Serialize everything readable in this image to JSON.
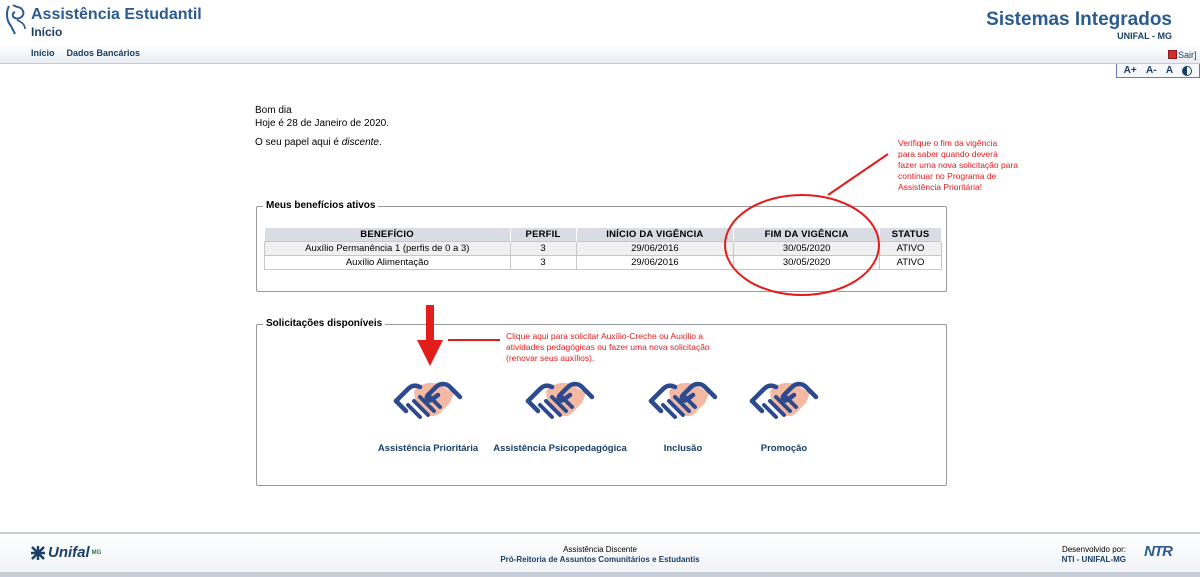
{
  "header": {
    "app_title": "Assistência Estudantil",
    "page_subtitle": "Início",
    "menu": [
      {
        "label": "Início"
      },
      {
        "label": "Dados Bancários"
      }
    ],
    "system_title": "Sistemas Integrados",
    "system_subtitle": "UNIFAL - MG",
    "logout_label": "Sair]",
    "accessibility": [
      "A+",
      "A-",
      "A"
    ]
  },
  "greeting": {
    "line1": "Bom dia",
    "line2": "Hoje é 28 de Janeiro de 2020.",
    "role_prefix": "O seu papel aqui é ",
    "role_value": "discente",
    "role_suffix": "."
  },
  "benefits": {
    "legend": "Meus benefícios ativos",
    "columns": [
      "BENEFÍCIO",
      "PERFIL",
      "INÍCIO DA VIGÊNCIA",
      "FIM DA VIGÊNCIA",
      "STATUS"
    ],
    "rows": [
      [
        "Auxílio Permanência 1 (perfis de 0 a 3)",
        "3",
        "29/06/2016",
        "30/05/2020",
        "ATIVO"
      ],
      [
        "Auxílio Alimentação",
        "3",
        "29/06/2016",
        "30/05/2020",
        "ATIVO"
      ]
    ]
  },
  "requests": {
    "legend": "Solicitações disponíveis",
    "items": [
      {
        "label": "Assistência Prioritária",
        "icon": "handshake-icon"
      },
      {
        "label": "Assistência Psicopedagógica",
        "icon": "handshake-icon"
      },
      {
        "label": "Inclusão",
        "icon": "handshake-icon"
      },
      {
        "label": "Promoção",
        "icon": "handshake-icon"
      }
    ]
  },
  "annotations": {
    "vigencia_note": [
      "Verifique o fim da vigência",
      "para saber quando deverá",
      "fazer uma nova solicitação para",
      "continuar no Programa de",
      "Assistência Prioritária!"
    ],
    "request_note": [
      "Clique aqui para solicitar Auxílio-Creche ou Auxílio a",
      "atividades pedagógicas ou fazer uma nova solicitação",
      "(renovar seus auxílios)."
    ],
    "color": "#e31c1c"
  },
  "footer": {
    "logo_text": "Unifal",
    "logo_mg": "MG",
    "center_line1": "Assistência Discente",
    "center_line2": "Pró-Reitoria de Assuntos Comunitários e Estudantis",
    "right_line1": "Desenvolvido por:",
    "right_line2": "NTI - UNIFAL-MG",
    "ntr_logo": "NTR"
  },
  "colors": {
    "brand": "#2b5c8f",
    "brand_dark": "#1a3f66",
    "icon_blue": "#2e4a8f",
    "icon_skin": "#f3b9a3"
  }
}
